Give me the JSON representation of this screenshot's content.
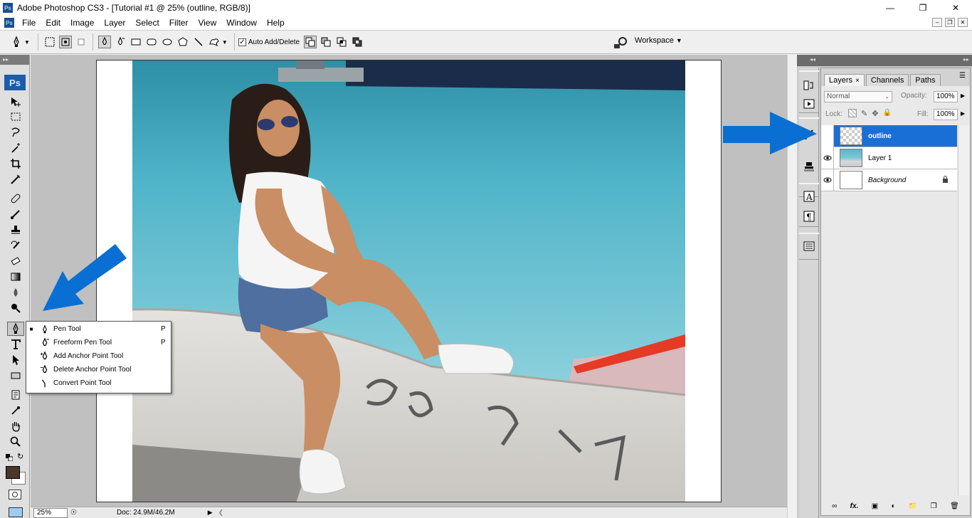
{
  "window": {
    "app_icon": "Ps",
    "title": "Adobe Photoshop CS3 - [Tutorial #1 @ 25% (outline, RGB/8)]"
  },
  "menu": [
    "File",
    "Edit",
    "Image",
    "Layer",
    "Select",
    "Filter",
    "View",
    "Window",
    "Help"
  ],
  "options_bar": {
    "auto_add_delete_label": "Auto Add/Delete",
    "auto_add_delete_checked": true,
    "workspace_label": "Workspace"
  },
  "toolbox": {
    "logo": "Ps",
    "foreground_color": "#4a3728",
    "background_color": "#ffffff"
  },
  "pen_flyout": {
    "items": [
      {
        "label": "Pen Tool",
        "key": "P",
        "selected": true
      },
      {
        "label": "Freeform Pen Tool",
        "key": "P"
      },
      {
        "label": "Add Anchor Point Tool",
        "key": ""
      },
      {
        "label": "Delete Anchor Point Tool",
        "key": ""
      },
      {
        "label": "Convert Point Tool",
        "key": ""
      }
    ]
  },
  "status": {
    "zoom": "25%",
    "doc": "Doc: 24.9M/46.2M"
  },
  "layers_panel": {
    "tabs": [
      "Layers",
      "Channels",
      "Paths"
    ],
    "active_tab": "Layers",
    "blend_mode": "Normal",
    "opacity_label": "Opacity:",
    "opacity": "100%",
    "lock_label": "Lock:",
    "fill_label": "Fill:",
    "fill": "100%",
    "layers": [
      {
        "name": "outline",
        "selected": true,
        "visible": false,
        "thumb": "transparent"
      },
      {
        "name": "Layer 1",
        "selected": false,
        "visible": true,
        "thumb": "photo"
      },
      {
        "name": "Background",
        "selected": false,
        "visible": true,
        "thumb": "white",
        "locked": true
      }
    ]
  },
  "annotations": {
    "arrow_color": "#0a6fd3"
  }
}
